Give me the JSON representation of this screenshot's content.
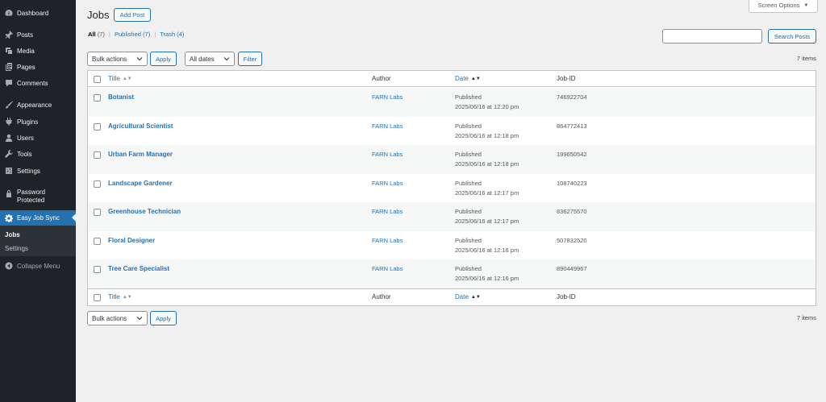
{
  "sidebar": {
    "items": [
      {
        "label": "Dashboard",
        "icon": "dashboard-icon"
      },
      {
        "label": "Posts",
        "icon": "pin-icon"
      },
      {
        "label": "Media",
        "icon": "media-icon"
      },
      {
        "label": "Pages",
        "icon": "pages-icon"
      },
      {
        "label": "Comments",
        "icon": "comment-icon"
      },
      {
        "label": "Appearance",
        "icon": "brush-icon"
      },
      {
        "label": "Plugins",
        "icon": "plugin-icon"
      },
      {
        "label": "Users",
        "icon": "user-icon"
      },
      {
        "label": "Tools",
        "icon": "wrench-icon"
      },
      {
        "label": "Settings",
        "icon": "settings-icon"
      },
      {
        "label": "Password Protected",
        "icon": "lock-icon"
      },
      {
        "label": "Easy Job Sync",
        "icon": "gear-icon"
      }
    ],
    "submenu": [
      "Jobs",
      "Settings"
    ],
    "collapse_label": "Collapse Menu"
  },
  "header": {
    "title": "Jobs",
    "add_button": "Add Post",
    "screen_options": "Screen Options"
  },
  "views": {
    "all": {
      "label": "All",
      "count": "(7)"
    },
    "published": {
      "label": "Published",
      "count": "(7)"
    },
    "trash": {
      "label": "Trash",
      "count": "(4)"
    },
    "separator": "|"
  },
  "search": {
    "button": "Search Posts",
    "value": ""
  },
  "tablenav_top": {
    "bulk_actions": "Bulk actions",
    "apply": "Apply",
    "dates": "All dates",
    "filter": "Filter",
    "items_count": "7 items"
  },
  "tablenav_bottom": {
    "bulk_actions": "Bulk actions",
    "apply": "Apply",
    "items_count": "7 items"
  },
  "table": {
    "columns": {
      "title": "Title",
      "author": "Author",
      "date": "Date",
      "jobid": "Job-ID"
    },
    "rows": [
      {
        "title": "Botanist",
        "author": "FARN Labs",
        "status": "Published",
        "date": "2025/06/16 at 12:20 pm",
        "jobid": "746922704"
      },
      {
        "title": "Agricultural Scientist",
        "author": "FARN Labs",
        "status": "Published",
        "date": "2025/06/16 at 12:18 pm",
        "jobid": "864772413"
      },
      {
        "title": "Urban Farm Manager",
        "author": "FARN Labs",
        "status": "Published",
        "date": "2025/06/16 at 12:18 pm",
        "jobid": "199650542"
      },
      {
        "title": "Landscape Gardener",
        "author": "FARN Labs",
        "status": "Published",
        "date": "2025/06/16 at 12:17 pm",
        "jobid": "108740223"
      },
      {
        "title": "Greenhouse Technician",
        "author": "FARN Labs",
        "status": "Published",
        "date": "2025/06/16 at 12:17 pm",
        "jobid": "836275570"
      },
      {
        "title": "Floral Designer",
        "author": "FARN Labs",
        "status": "Published",
        "date": "2025/06/16 at 12:16 pm",
        "jobid": "507832520"
      },
      {
        "title": "Tree Care Specialist",
        "author": "FARN Labs",
        "status": "Published",
        "date": "2025/06/16 at 12:16 pm",
        "jobid": "890449967"
      }
    ]
  },
  "colors": {
    "sidebar_bg": "#1d2327",
    "accent": "#2271b1",
    "page_bg": "#f0f0f1"
  }
}
